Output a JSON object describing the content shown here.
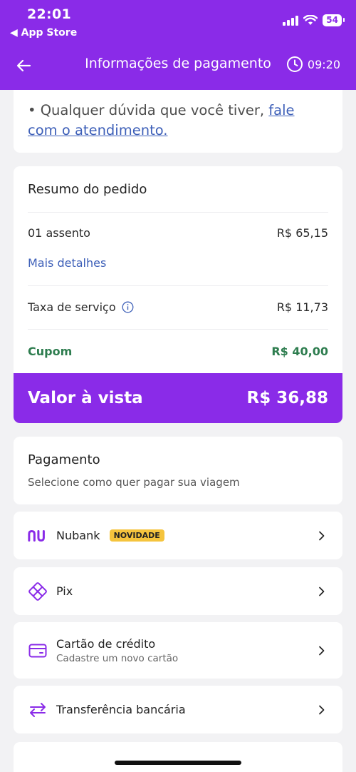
{
  "status_bar": {
    "time": "22:01",
    "back_app": "◀ App Store",
    "battery": "54"
  },
  "header": {
    "title": "Informações de pagamento",
    "timer": "09:20"
  },
  "help": {
    "text": "• Qualquer dúvida que você tiver, ",
    "link": "fale com o atendimento."
  },
  "summary": {
    "title": "Resumo do pedido",
    "seats_label": "01 assento",
    "seats_value": "R$ 65,15",
    "more_details": "Mais detalhes",
    "fee_label": "Taxa de serviço",
    "fee_value": "R$ 11,73",
    "coupon_label": "Cupom",
    "coupon_value": "R$ 40,00",
    "total_label": "Valor à vista",
    "total_value": "R$ 36,88"
  },
  "payment": {
    "title": "Pagamento",
    "subtitle": "Selecione como quer pagar sua viagem",
    "options": [
      {
        "label": "Nubank",
        "badge": "NOVIDADE",
        "icon": "nubank-logo"
      },
      {
        "label": "Pix",
        "icon": "pix-icon"
      },
      {
        "label": "Cartão de crédito",
        "sub": "Cadastre um novo cartão",
        "icon": "credit-card-icon"
      },
      {
        "label": "Transferência bancária",
        "icon": "transfer-icon"
      }
    ]
  },
  "colors": {
    "brand": "#8a2be8",
    "link": "#3d5fb8",
    "coupon": "#2e7d4f",
    "badge": "#f5c43d"
  }
}
